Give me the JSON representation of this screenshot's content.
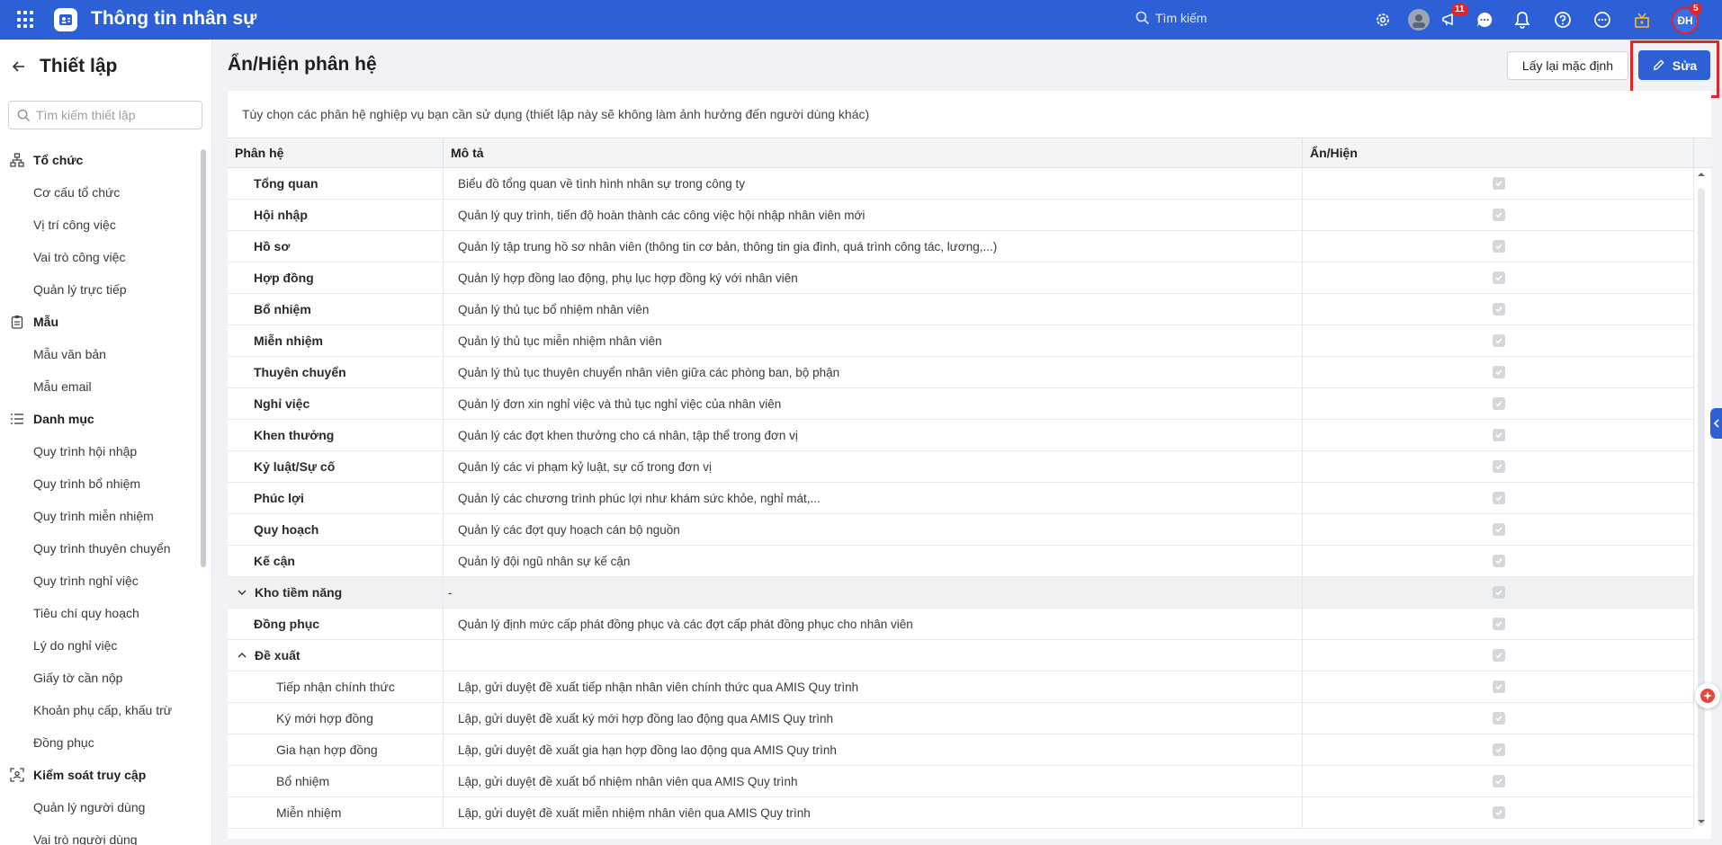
{
  "topbar": {
    "app_title": "Thông tin nhân sự",
    "search_placeholder": "Tìm kiếm",
    "announcements_badge": "11",
    "notifications_badge": "5",
    "user_initials": "ĐH",
    "brand_color": "#2d5fd6"
  },
  "sidebar": {
    "title": "Thiết lập",
    "search_placeholder": "Tìm kiếm thiết lập",
    "groups": [
      {
        "label": "Tổ chức",
        "icon": "org-chart-icon",
        "items": [
          "Cơ cấu tổ chức",
          "Vị trí công việc",
          "Vai trò công việc",
          "Quản lý trực tiếp"
        ]
      },
      {
        "label": "Mẫu",
        "icon": "clipboard-icon",
        "items": [
          "Mẫu văn bản",
          "Mẫu email"
        ]
      },
      {
        "label": "Danh mục",
        "icon": "list-icon",
        "items": [
          "Quy trình hội nhập",
          "Quy trình bổ nhiệm",
          "Quy trình miễn nhiệm",
          "Quy trình thuyên chuyển",
          "Quy trình nghỉ việc",
          "Tiêu chí quy hoạch",
          "Lý do nghỉ việc",
          "Giấy tờ cần nộp",
          "Khoản phụ cấp, khấu trừ",
          "Đồng phục"
        ]
      },
      {
        "label": "Kiểm soát truy cập",
        "icon": "user-scan-icon",
        "items": [
          "Quản lý người dùng",
          "Vai trò người dùng"
        ]
      }
    ]
  },
  "main": {
    "title": "Ẩn/Hiện phân hệ",
    "reset_button": "Lấy lại mặc định",
    "edit_button": "Sửa",
    "description": "Tùy chọn các phân hệ nghiệp vụ bạn cần sử dụng (thiết lập này sẽ không làm ảnh hưởng đến người dùng khác)",
    "columns": [
      "Phân hệ",
      "Mô tả",
      "Ẩn/Hiện"
    ],
    "rows": [
      {
        "name": "Tổng quan",
        "desc": "Biểu đồ tổng quan về tình hình nhân sự trong công ty",
        "type": "item"
      },
      {
        "name": "Hội nhập",
        "desc": "Quản lý quy trình, tiến độ hoàn thành các công việc hội nhập nhân viên mới",
        "type": "item"
      },
      {
        "name": "Hồ sơ",
        "desc": "Quản lý tập trung hồ sơ nhân viên (thông tin cơ bản, thông tin gia đình, quá trình công tác, lương,...)",
        "type": "item"
      },
      {
        "name": "Hợp đồng",
        "desc": "Quản lý hợp đồng lao động, phụ lục hợp đồng ký với nhân viên",
        "type": "item"
      },
      {
        "name": "Bổ nhiệm",
        "desc": "Quản lý thủ tục bổ nhiệm nhân viên",
        "type": "item"
      },
      {
        "name": "Miễn nhiệm",
        "desc": "Quản lý thủ tục miễn nhiệm nhân viên",
        "type": "item"
      },
      {
        "name": "Thuyên chuyển",
        "desc": "Quản lý thủ tục thuyên chuyển nhân viên giữa các phòng ban, bộ phận",
        "type": "item"
      },
      {
        "name": "Nghỉ việc",
        "desc": "Quản lý đơn xin nghỉ việc và thủ tục nghỉ việc của nhân viên",
        "type": "item"
      },
      {
        "name": "Khen thưởng",
        "desc": "Quản lý các đợt khen thưởng cho cá nhân, tập thể trong đơn vị",
        "type": "item"
      },
      {
        "name": "Kỷ luật/Sự cố",
        "desc": "Quản lý các vi phạm kỷ luật, sự cố trong đơn vị",
        "type": "item"
      },
      {
        "name": "Phúc lợi",
        "desc": "Quản lý các chương trình phúc lợi như khám sức khỏe, nghỉ mát,...",
        "type": "item"
      },
      {
        "name": "Quy hoạch",
        "desc": "Quản lý các đợt quy hoạch cán bộ nguồn",
        "type": "item"
      },
      {
        "name": "Kế cận",
        "desc": "Quản lý đội ngũ nhân sự kế cận",
        "type": "item"
      },
      {
        "name": "Kho tiềm năng",
        "desc": "-",
        "type": "group-collapsed"
      },
      {
        "name": "Đồng phục",
        "desc": "Quản lý định mức cấp phát đồng phục và các đợt cấp phát đồng phục cho nhân viên",
        "type": "item"
      },
      {
        "name": "Đề xuất",
        "desc": "",
        "type": "group-expanded"
      },
      {
        "name": "Tiếp nhận chính thức",
        "desc": "Lập, gửi duyệt đề xuất tiếp nhận nhân viên chính thức qua AMIS Quy trình",
        "type": "child"
      },
      {
        "name": "Ký mới hợp đồng",
        "desc": "Lập, gửi duyệt đề xuất ký mới hợp đồng lao động qua AMIS Quy trình",
        "type": "child"
      },
      {
        "name": "Gia hạn hợp đồng",
        "desc": "Lập, gửi duyệt đề xuất gia hạn hợp đồng lao động qua AMIS Quy trình",
        "type": "child"
      },
      {
        "name": "Bổ nhiệm",
        "desc": "Lập, gửi duyệt đề xuất bổ nhiệm nhân viên qua AMIS Quy trình",
        "type": "child"
      },
      {
        "name": "Miễn nhiệm",
        "desc": "Lập, gửi duyệt đề xuất miễn nhiệm nhân viên qua AMIS Quy trình",
        "type": "child"
      }
    ]
  }
}
